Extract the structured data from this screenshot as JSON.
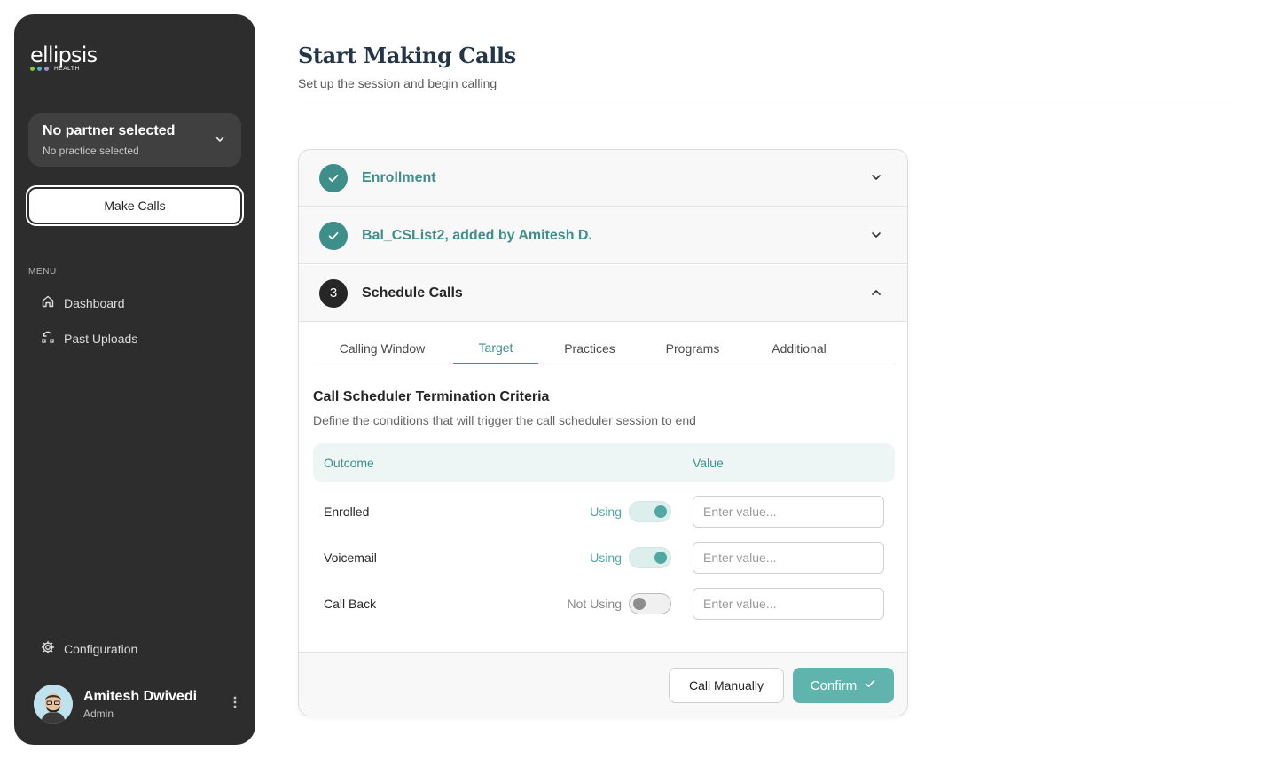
{
  "colors": {
    "sidebar_bg": "#2d2d2d",
    "accent": "#3e8f8a",
    "accent_light": "#5fb4ad",
    "title": "#233547"
  },
  "brand": {
    "name": "ellipsis",
    "sub": "HEALTH",
    "dot_colors": [
      "#8cc63f",
      "#4fb0c6",
      "#a58fd0"
    ]
  },
  "sidebar": {
    "partner": {
      "title": "No partner selected",
      "subtitle": "No practice selected"
    },
    "make_calls_label": "Make Calls",
    "menu_label": "MENU",
    "items": [
      {
        "label": "Dashboard",
        "icon": "home-icon"
      },
      {
        "label": "Past Uploads",
        "icon": "uploads-icon"
      }
    ],
    "configuration_label": "Configuration",
    "user": {
      "name": "Amitesh Dwivedi",
      "role": "Admin"
    }
  },
  "page": {
    "title": "Start Making Calls",
    "subtitle": "Set up the session and begin calling"
  },
  "steps": [
    {
      "label": "Enrollment",
      "status": "done"
    },
    {
      "label": "Bal_CSList2, added by Amitesh D.",
      "status": "done"
    },
    {
      "number": "3",
      "label": "Schedule Calls",
      "status": "active"
    }
  ],
  "tabs": [
    {
      "label": "Calling Window"
    },
    {
      "label": "Target",
      "active": true
    },
    {
      "label": "Practices"
    },
    {
      "label": "Programs"
    },
    {
      "label": "Additional"
    }
  ],
  "section": {
    "title": "Call Scheduler Termination Criteria",
    "subtitle": "Define the conditions that will trigger the call scheduler session to end"
  },
  "table": {
    "headers": {
      "outcome": "Outcome",
      "value": "Value"
    },
    "rows": [
      {
        "outcome": "Enrolled",
        "state": "Using",
        "enabled": true,
        "value": "",
        "placeholder": "Enter value..."
      },
      {
        "outcome": "Voicemail",
        "state": "Using",
        "enabled": true,
        "value": "",
        "placeholder": "Enter value..."
      },
      {
        "outcome": "Call Back",
        "state": "Not Using",
        "enabled": false,
        "value": "",
        "placeholder": "Enter value..."
      }
    ]
  },
  "footer": {
    "manual_label": "Call Manually",
    "confirm_label": "Confirm"
  }
}
